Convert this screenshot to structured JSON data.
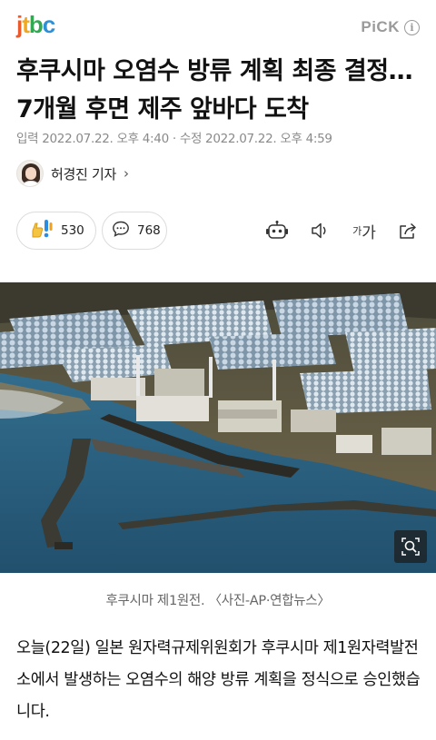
{
  "header": {
    "logo": {
      "j": "j",
      "t": "t",
      "b": "b",
      "c": "c"
    },
    "pick_label": "PiCK",
    "info_symbol": "i"
  },
  "article": {
    "title": "후쿠시마 오염수 방류 계획 최종 결정…7개월 후면 제주 앞바다 도착",
    "dates": "입력 2022.07.22. 오후 4:40 · 수정 2022.07.22. 오후 4:59",
    "reporter": "허경진 기자",
    "reporter_chevron": "›",
    "reaction_count": "530",
    "comment_count": "768",
    "font_size_label_small": "가",
    "font_size_label_large": "가",
    "photo_caption": "후쿠시마 제1원전. 〈사진-AP·연합뉴스〉",
    "body": "오늘(22일) 일본 원자력규제위원회가 후쿠시마 제1원자력발전소에서 발생하는 오염수의 해양 방류 계획을 정식으로 승인했습니다."
  },
  "icons": {
    "reaction": "reaction-emoji-icon",
    "comment": "comment-bubble-icon",
    "robot": "robot-summary-icon",
    "sound": "speaker-icon",
    "font": "font-size-icon",
    "share": "share-icon",
    "zoom": "zoom-search-icon"
  },
  "colors": {
    "logo_j": "#ea5a2b",
    "logo_t": "#f2a81d",
    "logo_b": "#33a853",
    "logo_c": "#2d8fd6",
    "sea": "#2f6a8c"
  }
}
